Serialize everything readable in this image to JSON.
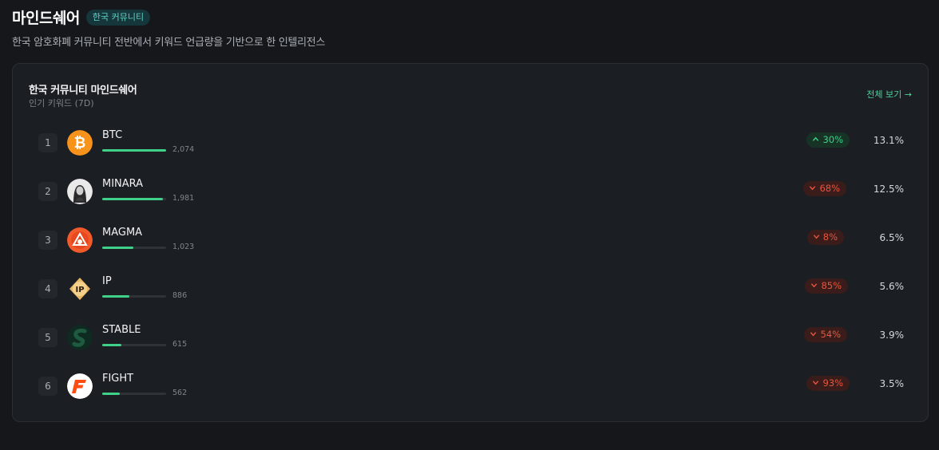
{
  "header": {
    "title": "마인드쉐어",
    "tag": "한국 커뮤니티",
    "subtitle": "한국 암호화폐 커뮤니티 전반에서 키워드 언급량을 기반으로 한 인텔리전스"
  },
  "card": {
    "title": "한국 커뮤니티 마인드쉐어",
    "subtitle": "인기 키워드 (7D)",
    "view_all": "전체 보기 →"
  },
  "colors": {
    "accent_green": "#3fd18a",
    "accent_red": "#e5553f",
    "tag_teal": "#5fd3c6"
  },
  "rows": [
    {
      "rank": "1",
      "name": "BTC",
      "count": "2,074",
      "bar": 1.0,
      "direction": "up",
      "change": "30%",
      "share": "13.1%",
      "icon": "bitcoin-icon"
    },
    {
      "rank": "2",
      "name": "MINARA",
      "count": "1,981",
      "bar": 0.95,
      "direction": "down",
      "change": "68%",
      "share": "12.5%",
      "icon": "minara-portrait-icon"
    },
    {
      "rank": "3",
      "name": "MAGMA",
      "count": "1,023",
      "bar": 0.49,
      "direction": "down",
      "change": "8%",
      "share": "6.5%",
      "icon": "magma-icon"
    },
    {
      "rank": "4",
      "name": "IP",
      "count": "886",
      "bar": 0.43,
      "direction": "down",
      "change": "85%",
      "share": "5.6%",
      "icon": "ip-icon"
    },
    {
      "rank": "5",
      "name": "STABLE",
      "count": "615",
      "bar": 0.3,
      "direction": "down",
      "change": "54%",
      "share": "3.9%",
      "icon": "stable-icon"
    },
    {
      "rank": "6",
      "name": "FIGHT",
      "count": "562",
      "bar": 0.27,
      "direction": "down",
      "change": "93%",
      "share": "3.5%",
      "icon": "fight-icon"
    }
  ]
}
